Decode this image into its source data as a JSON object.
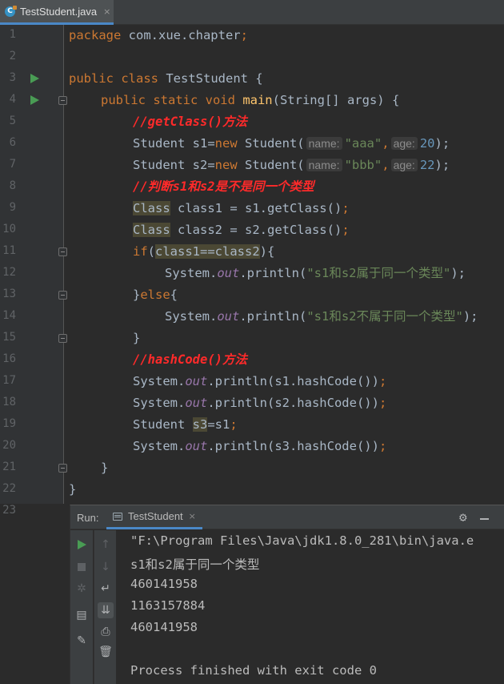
{
  "editor_tab": {
    "label": "TestStudent.java",
    "close": "×",
    "icon": "java-class-icon"
  },
  "code_lines": [
    {
      "n": "1",
      "indent": 0,
      "tokens": [
        [
          "kw",
          "package "
        ],
        [
          "",
          "com.xue.chapter"
        ],
        [
          "kw",
          ";"
        ]
      ]
    },
    {
      "n": "2",
      "indent": 0,
      "tokens": []
    },
    {
      "n": "3",
      "indent": 0,
      "run": true,
      "tokens": [
        [
          "kw",
          "public class "
        ],
        [
          "",
          "TestStudent {"
        ]
      ]
    },
    {
      "n": "4",
      "indent": 1,
      "run": true,
      "fold": true,
      "tokens": [
        [
          "kw",
          "public static void "
        ],
        [
          "fn",
          "main"
        ],
        [
          "",
          "(String[] args) {"
        ]
      ]
    },
    {
      "n": "5",
      "indent": 2,
      "tokens": [
        [
          "cmt",
          "//getClass()方法"
        ]
      ]
    },
    {
      "n": "6",
      "indent": 2,
      "tokens": [
        [
          "",
          "Student s1="
        ],
        [
          "kw",
          "new "
        ],
        [
          "",
          "Student("
        ],
        [
          "hint",
          "name:"
        ],
        [
          "str",
          "\"aaa\""
        ],
        [
          "kw",
          ","
        ],
        [
          "hint",
          "age:"
        ],
        [
          "num",
          "20"
        ],
        [
          "",
          "); "
        ]
      ]
    },
    {
      "n": "7",
      "indent": 2,
      "tokens": [
        [
          "",
          "Student s2="
        ],
        [
          "kw",
          "new "
        ],
        [
          "",
          "Student("
        ],
        [
          "hint",
          "name:"
        ],
        [
          "str",
          "\"bbb\""
        ],
        [
          "kw",
          ","
        ],
        [
          "hint",
          "age:"
        ],
        [
          "num",
          "22"
        ],
        [
          "",
          "); "
        ]
      ]
    },
    {
      "n": "8",
      "indent": 2,
      "tokens": [
        [
          "cmt",
          "//判断s1和s2是不是同一个类型"
        ]
      ]
    },
    {
      "n": "9",
      "indent": 2,
      "tokens": [
        [
          "hl",
          "Class"
        ],
        [
          "",
          " class1 = s1.getClass()"
        ],
        [
          "kw",
          ";"
        ]
      ]
    },
    {
      "n": "10",
      "indent": 2,
      "tokens": [
        [
          "hl",
          "Class"
        ],
        [
          "",
          " class2 = s2.getClass()"
        ],
        [
          "kw",
          ";"
        ]
      ]
    },
    {
      "n": "11",
      "indent": 2,
      "fold": true,
      "tokens": [
        [
          "kw",
          "if"
        ],
        [
          "",
          "("
        ],
        [
          "hl",
          "class1==class2"
        ],
        [
          "",
          "){"
        ]
      ]
    },
    {
      "n": "12",
      "indent": 3,
      "tokens": [
        [
          "",
          "System."
        ],
        [
          "fld",
          "out"
        ],
        [
          "",
          ".println("
        ],
        [
          "str",
          "\"s1和s2属于同一个类型\""
        ],
        [
          "",
          "); "
        ]
      ]
    },
    {
      "n": "13",
      "indent": 2,
      "fold": true,
      "tokens": [
        [
          "",
          "}"
        ],
        [
          "kw",
          "else"
        ],
        [
          "",
          "{"
        ]
      ]
    },
    {
      "n": "14",
      "indent": 3,
      "tokens": [
        [
          "",
          "System."
        ],
        [
          "fld",
          "out"
        ],
        [
          "",
          ".println("
        ],
        [
          "str",
          "\"s1和s2不属于同一个类型\""
        ],
        [
          "",
          "); "
        ]
      ]
    },
    {
      "n": "15",
      "indent": 2,
      "fold": true,
      "tokens": [
        [
          "",
          "}"
        ]
      ]
    },
    {
      "n": "16",
      "indent": 2,
      "tokens": [
        [
          "cmt",
          "//hashCode()方法"
        ]
      ]
    },
    {
      "n": "17",
      "indent": 2,
      "tokens": [
        [
          "",
          "System."
        ],
        [
          "fld",
          "out"
        ],
        [
          "",
          ".println(s1.hashCode())"
        ],
        [
          "kw",
          ";"
        ]
      ]
    },
    {
      "n": "18",
      "indent": 2,
      "tokens": [
        [
          "",
          "System."
        ],
        [
          "fld",
          "out"
        ],
        [
          "",
          ".println(s2.hashCode())"
        ],
        [
          "kw",
          ";"
        ]
      ]
    },
    {
      "n": "19",
      "indent": 2,
      "tokens": [
        [
          "",
          "Student "
        ],
        [
          "hl",
          "s3"
        ],
        [
          "",
          "=s1"
        ],
        [
          "kw",
          ";"
        ]
      ]
    },
    {
      "n": "20",
      "indent": 2,
      "tokens": [
        [
          "",
          "System."
        ],
        [
          "fld",
          "out"
        ],
        [
          "",
          ".println(s3.hashCode())"
        ],
        [
          "kw",
          ";"
        ]
      ]
    },
    {
      "n": "21",
      "indent": 1,
      "fold": true,
      "tokens": [
        [
          "",
          "}"
        ]
      ]
    },
    {
      "n": "22",
      "indent": 0,
      "tokens": [
        [
          "",
          "}"
        ]
      ]
    },
    {
      "n": "23",
      "indent": 0,
      "tokens": []
    }
  ],
  "run_panel": {
    "title": "Run:",
    "tab_label": "TestStudent",
    "tab_close": "×",
    "output": [
      "\"F:\\Program Files\\Java\\jdk1.8.0_281\\bin\\java.e",
      "s1和s2属于同一个类型",
      "460141958",
      "1163157884",
      "460141958",
      "",
      "Process finished with exit code 0"
    ]
  }
}
